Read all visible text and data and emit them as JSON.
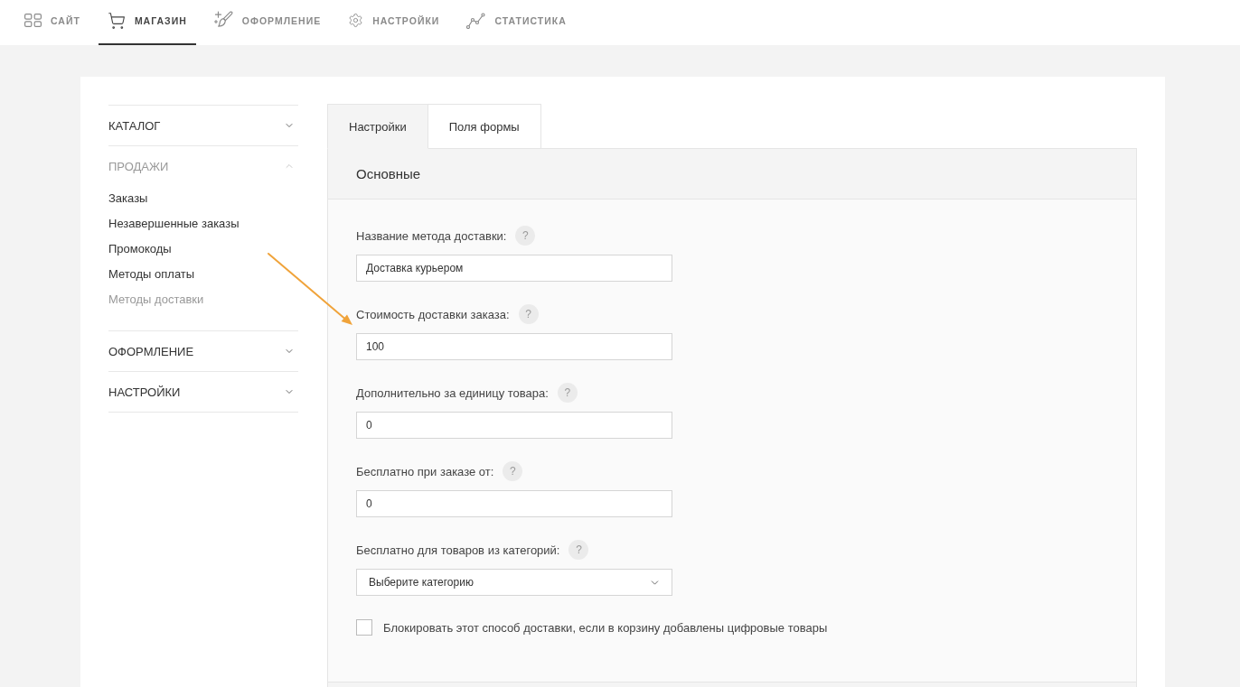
{
  "top_nav": [
    {
      "label": "САЙТ",
      "selected": false
    },
    {
      "label": "МАГАЗИН",
      "selected": true
    },
    {
      "label": "ОФОРМЛЕНИЕ",
      "selected": false
    },
    {
      "label": "НАСТРОЙКИ",
      "selected": false
    },
    {
      "label": "СТАТИСТИКА",
      "selected": false
    }
  ],
  "sidebar": {
    "sections": [
      {
        "title": "КАТАЛОГ",
        "expanded": false
      },
      {
        "title": "ПРОДАЖИ",
        "expanded": true,
        "children": [
          {
            "label": "Заказы",
            "selected": false
          },
          {
            "label": "Незавершенные заказы",
            "selected": false
          },
          {
            "label": "Промокоды",
            "selected": false
          },
          {
            "label": "Методы оплаты",
            "selected": false
          },
          {
            "label": "Методы доставки",
            "selected": true
          }
        ]
      },
      {
        "title": "ОФОРМЛЕНИЕ",
        "expanded": false
      },
      {
        "title": "НАСТРОЙКИ",
        "expanded": false
      }
    ]
  },
  "tabs": [
    {
      "label": "Настройки",
      "selected": true
    },
    {
      "label": "Поля формы",
      "selected": false
    }
  ],
  "panel": {
    "title": "Основные",
    "fields": [
      {
        "kind": "text",
        "label": "Название метода доставки:",
        "help": "?",
        "value": "Доставка курьером"
      },
      {
        "kind": "text",
        "label": "Стоимость доставки заказа:",
        "help": "?",
        "value": "100"
      },
      {
        "kind": "text",
        "label": "Дополнительно за единицу товара:",
        "help": "?",
        "value": "0"
      },
      {
        "kind": "text",
        "label": "Бесплатно при заказе от:",
        "help": "?",
        "value": "0"
      },
      {
        "kind": "select",
        "label": "Бесплатно для товаров из категорий:",
        "help": "?",
        "value": "Выберите категорию"
      }
    ],
    "checkbox": {
      "label": "Блокировать этот способ доставки, если в корзину добавлены цифровые товары",
      "checked": false
    }
  }
}
